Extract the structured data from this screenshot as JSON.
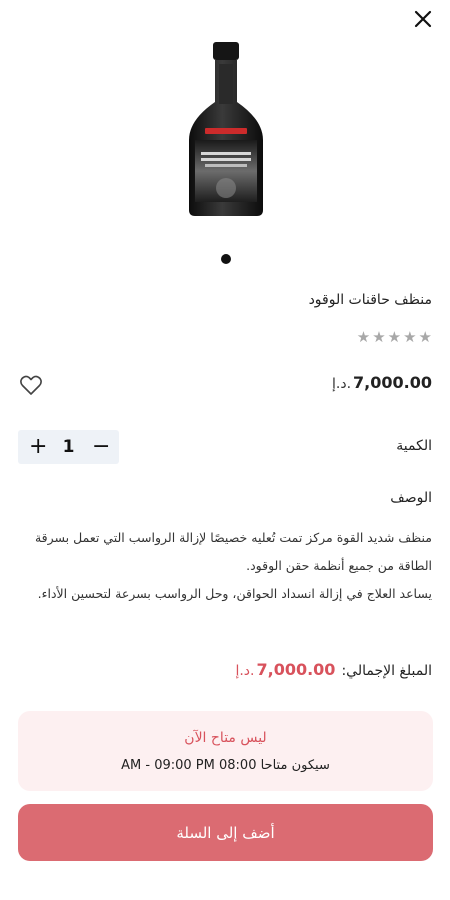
{
  "product": {
    "title": "منظف حاقنات الوقود",
    "rating": 0,
    "rating_max": 5,
    "price_amount": "7,000.00",
    "currency": "د.إ."
  },
  "quantity": {
    "label": "الكمية",
    "value": "1",
    "plus": "+",
    "minus": "−"
  },
  "description": {
    "heading": "الوصف",
    "line1": "منظف شديد القوة مركز تمت تُعليه خصيصًا لإزالة الرواسب التي تعمل بسرقة الطاقة من جميع أنظمة حقن الوقود.",
    "line2": "يساعد العلاج في إزالة انسداد الحواقن، وحل الرواسب بسرعة لتحسين الأداء."
  },
  "total": {
    "label": "المبلغ الإجمالي:",
    "amount": "7,000.00",
    "currency": "د.إ."
  },
  "availability": {
    "title": "ليس متاح الآن",
    "subtitle": "سيكون متاحا 08:00 AM - 09:00 PM"
  },
  "actions": {
    "add_to_cart": "أضف إلى السلة"
  },
  "colors": {
    "accent": "#d8525c",
    "button_bg": "#db6b72",
    "notice_bg": "#fdf0f1",
    "stepper_bg": "#eef2f7",
    "star": "#a8a8a8"
  },
  "icons": {
    "close": "close-icon",
    "favorite": "heart-outline-icon",
    "star": "star-icon"
  }
}
